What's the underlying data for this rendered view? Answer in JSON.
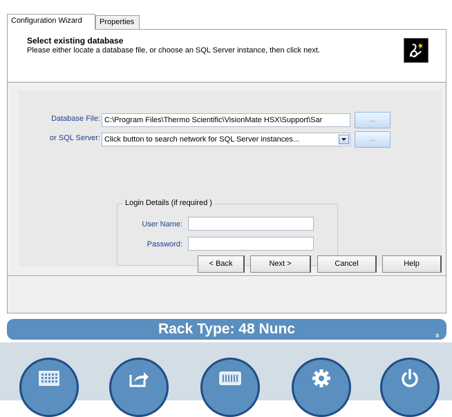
{
  "tabs": [
    {
      "label": "Configuration Wizard",
      "active": true
    },
    {
      "label": "Properties",
      "active": false
    }
  ],
  "header": {
    "title": "Select existing database",
    "subtitle": "Please either locate a database file, or choose an SQL Server instance, then click next."
  },
  "form": {
    "database_file_label": "Database File:",
    "database_file_value": "C:\\Program Files\\Thermo Scientific\\VisionMate HSX\\Support\\Sar",
    "sql_server_label": "or SQL Server:",
    "sql_server_value": "Click button to search network for SQL Server instances...",
    "browse_label": "...",
    "login_group_label": "Login Details (if required )",
    "user_name_label": "User Name:",
    "user_name_value": "",
    "password_label": "Password:",
    "password_value": ""
  },
  "buttons": {
    "back": "< Back",
    "next": "Next >",
    "cancel": "Cancel",
    "help": "Help"
  },
  "rack_bar": {
    "text": "Rack Type: 48 Nunc",
    "chevron": "»"
  },
  "toolbar_icons": [
    "grid-icon",
    "export-icon",
    "rack-icon",
    "gear-icon",
    "power-icon"
  ],
  "colors": {
    "accent": "#5a8fbf",
    "accent_dark": "#1f4d86",
    "label_blue": "#1f3f8f"
  }
}
